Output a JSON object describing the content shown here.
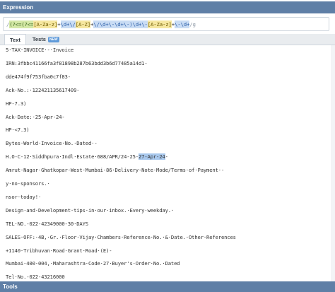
{
  "expression_header": "Expression",
  "expression": {
    "tokens": [
      {
        "t": "/",
        "k": "slash"
      },
      {
        "t": "(?<=(?<=",
        "k": "group"
      },
      {
        "t": "[A-Za-z]",
        "k": "set"
      },
      {
        "t": "+",
        "k": "plain"
      },
      {
        "t": "\\d+",
        "k": "esc"
      },
      {
        "t": "\\/",
        "k": "esc"
      },
      {
        "t": "[A-Z]",
        "k": "set"
      },
      {
        "t": "+",
        "k": "plain"
      },
      {
        "t": "\\/",
        "k": "esc"
      },
      {
        "t": "\\d+",
        "k": "esc"
      },
      {
        "t": "\\-",
        "k": "esc"
      },
      {
        "t": "\\d+",
        "k": "esc"
      },
      {
        "t": "\\-)",
        "k": "esc"
      },
      {
        "t": "\\d+",
        "k": "esc"
      },
      {
        "t": "\\-",
        "k": "esc"
      },
      {
        "t": "[A-Za-z]",
        "k": "set"
      },
      {
        "t": "+",
        "k": "plain"
      },
      {
        "t": "\\-",
        "k": "esc"
      },
      {
        "t": "\\d+",
        "k": "esc"
      },
      {
        "t": "/g",
        "k": "flags"
      }
    ]
  },
  "tabs": [
    {
      "label": "Text",
      "active": true
    },
    {
      "label": "Tests",
      "badge": "NEW",
      "active": false
    }
  ],
  "text_lines": [
    {
      "parts": [
        {
          "text": "5·TAX·INVOICE·-·Invoice"
        }
      ]
    },
    {
      "parts": [
        {
          "text": "IRN:3fbbc41166fa3f81898b287b63bdd3b6d77485a14d1-"
        }
      ]
    },
    {
      "parts": [
        {
          "text": "dde474f9f753fba0c7f83-"
        }
      ]
    },
    {
      "parts": [
        {
          "text": "Ack·No.:·122421135617409-"
        }
      ]
    },
    {
      "parts": [
        {
          "text": "HP-7.3)"
        }
      ]
    },
    {
      "parts": [
        {
          "text": "Ack·Date:·25-Apr-24-"
        }
      ]
    },
    {
      "parts": [
        {
          "text": "HP·<7.3)"
        }
      ]
    },
    {
      "parts": [
        {
          "text": "Bytes·World·Invoice·No.·Dated·-"
        }
      ]
    },
    {
      "parts": [
        {
          "text": "H.O-C-12·Siddhpura·Indl·Estate·688/APR/24-25-"
        },
        {
          "text": "27-Apr-24",
          "match": true
        },
        {
          "text": "-"
        }
      ]
    },
    {
      "parts": [
        {
          "text": "Amrut·Nagar·Ghatkopar·West·Mumbai-86·Delivery·Note·Mode/Terms·of·Payment·-"
        }
      ]
    },
    {
      "parts": [
        {
          "text": "y·no·sponsors.·"
        }
      ]
    },
    {
      "parts": [
        {
          "text": "nsor·today!·"
        }
      ]
    },
    {
      "parts": [
        {
          "text": "Design·and·Development·tips·in·our·inbox.·Every·weekday.·"
        }
      ]
    },
    {
      "parts": [
        {
          "text": "TEL·NO.-022-42349000-30·DAYS"
        }
      ]
    },
    {
      "parts": [
        {
          "text": "SALES·OFF:·4B,·Gr.·Floor·Vijay·Chambers·Reference·No.·&·Date.·Other·References"
        }
      ]
    },
    {
      "parts": [
        {
          "text": "+1140·Tribhuvan·Road·Grant·Road·(E)-"
        }
      ]
    },
    {
      "parts": [
        {
          "text": "Mumbai-400-004,·Maharashtra·Code·27·Buyer's·Order·No.·Dated"
        }
      ]
    },
    {
      "parts": [
        {
          "text": "Tel·No.-022-43216000"
        }
      ]
    }
  ],
  "tools_header": "Tools"
}
